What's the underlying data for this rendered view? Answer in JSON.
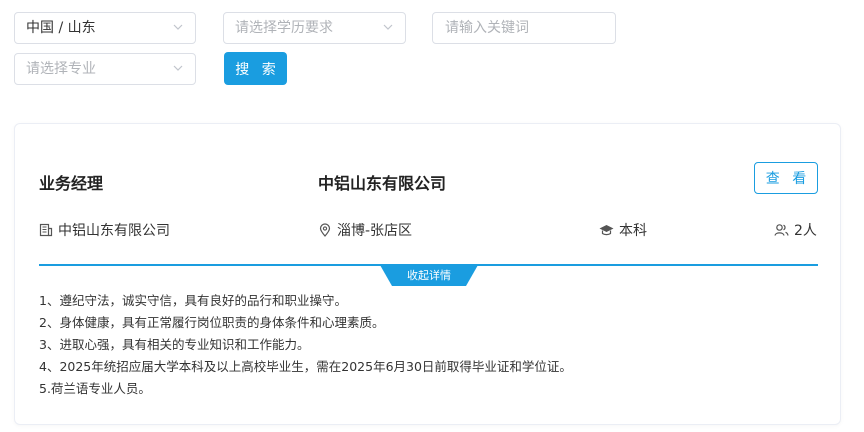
{
  "filters": {
    "region": {
      "value": "中国 / 山东"
    },
    "education": {
      "placeholder": "请选择学历要求"
    },
    "keyword": {
      "placeholder": "请输入关键词"
    },
    "major": {
      "placeholder": "请选择专业"
    },
    "search_label": "搜 索"
  },
  "job": {
    "title": "业务经理",
    "company_title": "中铝山东有限公司",
    "view_label": "查 看",
    "company": "中铝山东有限公司",
    "location": "淄博-张店区",
    "education": "本科",
    "headcount": "2人",
    "collapse_label": "收起详情",
    "requirements": [
      "1、遵纪守法，诚实守信，具有良好的品行和职业操守。",
      "2、身体健康，具有正常履行岗位职责的身体条件和心理素质。",
      "3、进取心强，具有相关的专业知识和工作能力。",
      "4、2025年统招应届大学本科及以上高校毕业生，需在2025年6月30日前取得毕业证和学位证。",
      "5.荷兰语专业人员。"
    ]
  },
  "icons": {
    "company": "building-icon",
    "location": "location-pin-icon",
    "education": "graduation-cap-icon",
    "headcount": "people-icon",
    "dropdown": "chevron-down-icon"
  },
  "colors": {
    "accent": "#1a9de0",
    "border": "#dcdfe6",
    "placeholder": "#b0b3b8"
  }
}
